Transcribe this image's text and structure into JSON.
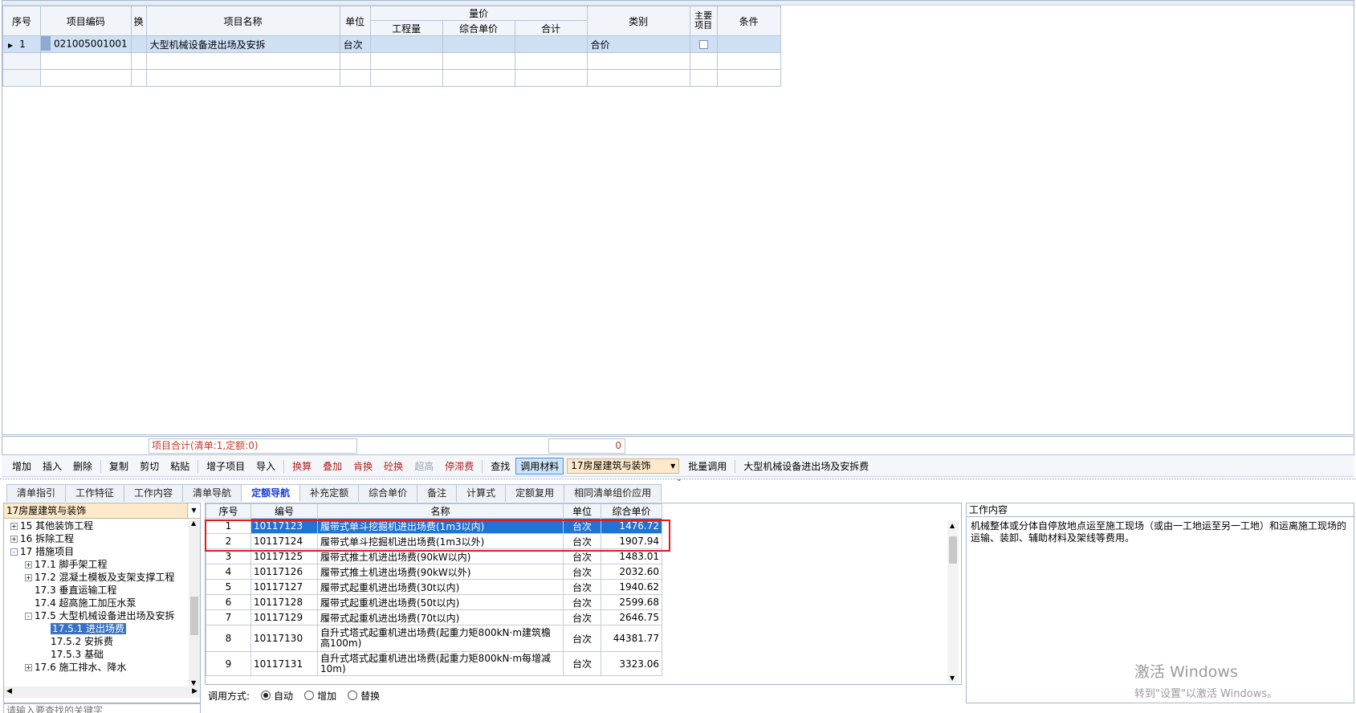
{
  "top_grid": {
    "headers": {
      "seq": "序号",
      "code": "项目编码",
      "swap": "换",
      "name": "项目名称",
      "unit": "单位",
      "qty_price": "量价",
      "quantity": "工程量",
      "unit_price": "综合单价",
      "total": "合计",
      "category": "类别",
      "main_item": "主要\n项目",
      "condition": "条件"
    },
    "rows": [
      {
        "seq": "1",
        "code": "021005001001",
        "name": "大型机械设备进出场及安拆",
        "unit": "台次",
        "category": "合价"
      }
    ]
  },
  "summary": {
    "label": "项目合计(清单:1,定额:0)",
    "value": "0"
  },
  "toolbar": {
    "add": "增加",
    "insert": "插入",
    "delete": "删除",
    "copy": "复制",
    "cut": "剪切",
    "paste": "粘贴",
    "add_subitem": "增子项目",
    "import": "导入",
    "convert": "换算",
    "overlay": "叠加",
    "rebar": "肯换",
    "concrete": "砼换",
    "super_high": "超高",
    "stoppage_fee": "停滞费",
    "find": "查找",
    "call_material": "调用材料",
    "library": "17房屋建筑与装饰",
    "batch_call": "批量调用",
    "current_item": "大型机械设备进出场及安拆费"
  },
  "tabs": [
    {
      "label": "清单指引"
    },
    {
      "label": "工作特征"
    },
    {
      "label": "工作内容"
    },
    {
      "label": "清单导航"
    },
    {
      "label": "定额导航",
      "active": true
    },
    {
      "label": "补充定额"
    },
    {
      "label": "综合单价"
    },
    {
      "label": "备注"
    },
    {
      "label": "计算式"
    },
    {
      "label": "定额复用"
    },
    {
      "label": "相同清单组价应用"
    }
  ],
  "tree": {
    "library": "17房屋建筑与装饰",
    "nodes": [
      {
        "label": "15 其他装饰工程",
        "toggle": "+"
      },
      {
        "label": "16 拆除工程",
        "toggle": "+"
      },
      {
        "label": "17 措施项目",
        "toggle": "-"
      },
      {
        "label": "17.1 脚手架工程",
        "toggle": "+"
      },
      {
        "label": "17.2 混凝土模板及支架支撑工程",
        "toggle": "+"
      },
      {
        "label": "17.3 垂直运输工程",
        "toggle": ""
      },
      {
        "label": "17.4 超高施工加压水泵",
        "toggle": ""
      },
      {
        "label": "17.5 大型机械设备进出场及安拆",
        "toggle": "-"
      },
      {
        "label": "17.5.1 进出场费",
        "toggle": "",
        "selected": true
      },
      {
        "label": "17.5.2 安拆费",
        "toggle": ""
      },
      {
        "label": "17.5.3 基础",
        "toggle": ""
      },
      {
        "label": "17.6 施工排水、降水",
        "toggle": "+"
      }
    ],
    "search_placeholder": "请输入要查找的关键字"
  },
  "quota_table": {
    "headers": {
      "seq": "序号",
      "code": "编号",
      "name": "名称",
      "unit": "单位",
      "price": "综合单价"
    },
    "rows": [
      {
        "seq": "1",
        "code": "10117123",
        "name": "履带式单斗挖掘机进出场费(1m3以内)",
        "unit": "台次",
        "price": "1476.72",
        "selected": true
      },
      {
        "seq": "2",
        "code": "10117124",
        "name": "履带式单斗挖掘机进出场费(1m3以外)",
        "unit": "台次",
        "price": "1907.94"
      },
      {
        "seq": "3",
        "code": "10117125",
        "name": "履带式推土机进出场费(90kW以内)",
        "unit": "台次",
        "price": "1483.01"
      },
      {
        "seq": "4",
        "code": "10117126",
        "name": "履带式推土机进出场费(90kW以外)",
        "unit": "台次",
        "price": "2032.60"
      },
      {
        "seq": "5",
        "code": "10117127",
        "name": "履带式起重机进出场费(30t以内)",
        "unit": "台次",
        "price": "1940.62"
      },
      {
        "seq": "6",
        "code": "10117128",
        "name": "履带式起重机进出场费(50t以内)",
        "unit": "台次",
        "price": "2599.68"
      },
      {
        "seq": "7",
        "code": "10117129",
        "name": "履带式起重机进出场费(70t以内)",
        "unit": "台次",
        "price": "2646.75"
      },
      {
        "seq": "8",
        "code": "10117130",
        "name": "自升式塔式起重机进出场费(起重力矩800kN·m建筑檐高100m)",
        "unit": "台次",
        "price": "44381.77"
      },
      {
        "seq": "9",
        "code": "10117131",
        "name": "自升式塔式起重机进出场费(起重力矩800kN·m每增减10m)",
        "unit": "台次",
        "price": "3323.06"
      }
    ]
  },
  "apply_mode": {
    "label": "调用方式:",
    "options": [
      "自动",
      "增加",
      "替换"
    ],
    "selected": "自动"
  },
  "work_content": {
    "title": "工作内容",
    "text": "机械整体或分体自停放地点运至施工现场（或由一工地运至另一工地）和运离施工现场的运输、装卸、辅助材料及架线等费用。"
  },
  "watermark": {
    "line1": "激活 Windows",
    "line2": "转到\"设置\"以激活 Windows。"
  }
}
